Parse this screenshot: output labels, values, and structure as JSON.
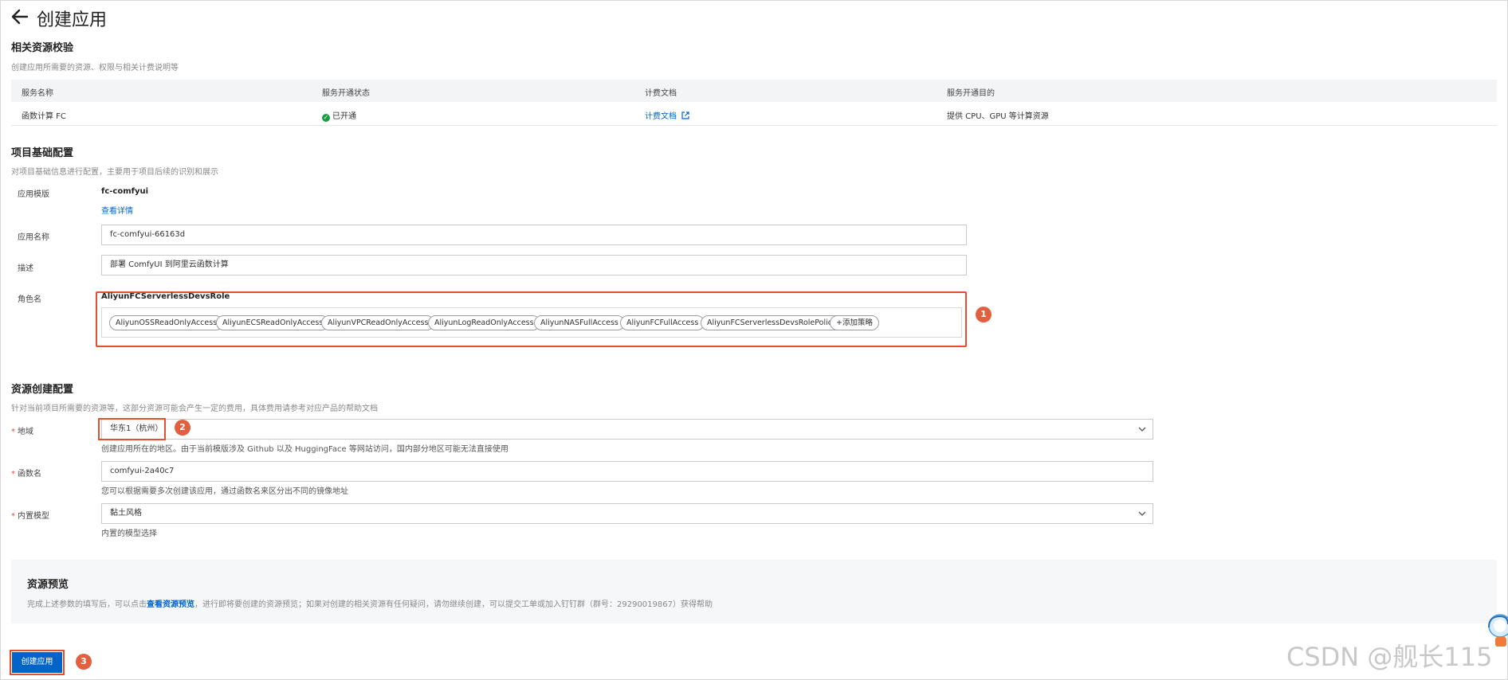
{
  "header": {
    "title": "创建应用"
  },
  "resources_check": {
    "title": "相关资源校验",
    "desc": "创建应用所需要的资源、权限与相关计费说明等",
    "columns": [
      "服务名称",
      "服务开通状态",
      "计费文档",
      "服务开通目的"
    ],
    "row": {
      "service": "函数计算 FC",
      "status": "已开通",
      "billing": "计费文档",
      "purpose": "提供 CPU、GPU 等计算资源"
    }
  },
  "basic_config": {
    "title": "项目基础配置",
    "desc": "对项目基础信息进行配置，主要用于项目后续的识别和展示",
    "template_label": "应用模版",
    "template_value": "fc-comfyui",
    "template_link": "查看详情",
    "name_label": "应用名称",
    "name_value": "fc-comfyui-66163d",
    "desc_label": "描述",
    "desc_value": "部署 ComfyUI 到阿里云函数计算",
    "role_label": "角色名",
    "role_value": "AliyunFCServerlessDevsRole",
    "policies": [
      "AliyunOSSReadOnlyAccess",
      "AliyunECSReadOnlyAccess",
      "AliyunVPCReadOnlyAccess",
      "AliyunLogReadOnlyAccess",
      "AliyunNASFullAccess",
      "AliyunFCFullAccess",
      "AliyunFCServerlessDevsRolePolicy"
    ],
    "add_policy": "添加策略"
  },
  "resource_config": {
    "title": "资源创建配置",
    "desc": "针对当前项目所需要的资源等，这部分资源可能会产生一定的费用，具体费用请参考对应产品的帮助文档",
    "region_label": "地域",
    "region_value": "华东1（杭州）",
    "region_hint": "创建应用所在的地区。由于当前模版涉及 Github 以及 HuggingFace 等网站访问，国内部分地区可能无法直接使用",
    "func_label": "函数名",
    "func_value": "comfyui-2a40c7",
    "func_hint": "您可以根据需要多次创建该应用，通过函数名来区分出不同的镜像地址",
    "model_label": "内置模型",
    "model_value": "黏土风格",
    "model_hint": "内置的模型选择"
  },
  "preview": {
    "title": "资源预览",
    "text_before": "完成上述参数的填写后，可以点击",
    "link": "查看资源预览",
    "text_after": "，进行即将要创建的资源预览；如果对创建的相关资源有任何疑问，请勿继续创建，可以提交工单或加入钉钉群（群号：29290019867）获得帮助"
  },
  "create_button": "创建应用",
  "annotations": [
    "1",
    "2",
    "3"
  ],
  "watermark": "CSDN @舰长115",
  "colors": {
    "primary": "#0064c8",
    "highlight": "#e2502f",
    "success": "#1a9e43"
  }
}
